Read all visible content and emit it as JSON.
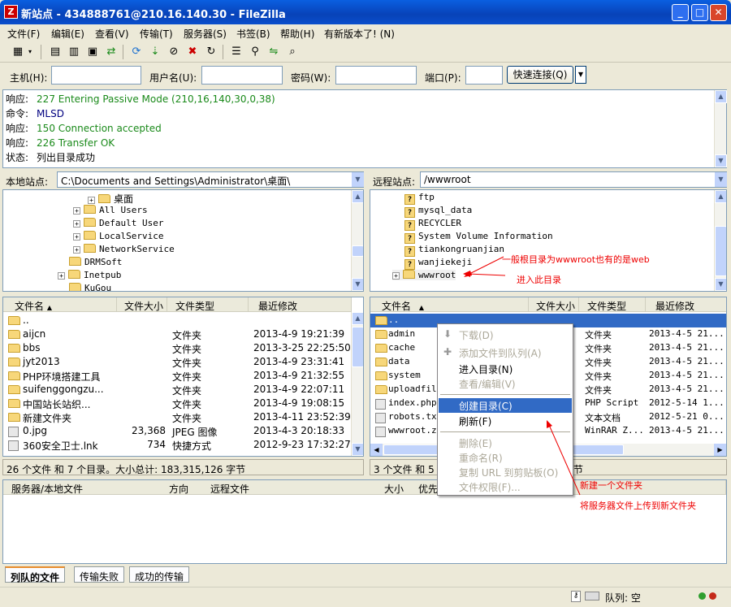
{
  "window": {
    "title": "新站点 - 434888761@210.16.140.30 - FileZilla",
    "min": "_",
    "max": "□",
    "close": "✕"
  },
  "menu": [
    "文件(F)",
    "编辑(E)",
    "查看(V)",
    "传输(T)",
    "服务器(S)",
    "书签(B)",
    "帮助(H)",
    "有新版本了! (N)"
  ],
  "quick": {
    "host_label": "主机(H):",
    "user_label": "用户名(U):",
    "pass_label": "密码(W):",
    "port_label": "端口(P):",
    "connect": "快速连接(Q)"
  },
  "log": [
    {
      "k": "响应:",
      "v": "227 Entering Passive Mode (210,16,140,30,0,38)",
      "c": "#008000"
    },
    {
      "k": "命令:",
      "v": "MLSD",
      "c": "#000080"
    },
    {
      "k": "响应:",
      "v": "150 Connection accepted",
      "c": "#008000"
    },
    {
      "k": "响应:",
      "v": "226 Transfer OK",
      "c": "#008000"
    },
    {
      "k": "状态:",
      "v": "列出目录成功",
      "c": "#000000"
    }
  ],
  "local": {
    "label": "本地站点:",
    "path": "C:\\Documents and Settings\\Administrator\\桌面\\",
    "tree": [
      "桌面",
      "All Users",
      "Default User",
      "LocalService",
      "NetworkService",
      "DRMSoft",
      "Inetpub",
      "KuGou"
    ],
    "headers": [
      "文件名",
      "文件大小",
      "文件类型",
      "最近修改"
    ],
    "rows": [
      {
        "n": "..",
        "s": "",
        "t": "",
        "d": ""
      },
      {
        "n": "aijcn",
        "s": "",
        "t": "文件夹",
        "d": "2013-4-9 19:21:39"
      },
      {
        "n": "bbs",
        "s": "",
        "t": "文件夹",
        "d": "2013-3-25 22:25:50"
      },
      {
        "n": "jyt2013",
        "s": "",
        "t": "文件夹",
        "d": "2013-4-9 23:31:41"
      },
      {
        "n": "PHP环境搭建工具",
        "s": "",
        "t": "文件夹",
        "d": "2013-4-9 21:32:55"
      },
      {
        "n": "suifenggongzu...",
        "s": "",
        "t": "文件夹",
        "d": "2013-4-9 22:07:11"
      },
      {
        "n": "中国站长站织...",
        "s": "",
        "t": "文件夹",
        "d": "2013-4-9 19:08:15"
      },
      {
        "n": "新建文件夹",
        "s": "",
        "t": "文件夹",
        "d": "2013-4-11 23:52:39"
      },
      {
        "n": "0.jpg",
        "s": "23,368",
        "t": "JPEG 图像",
        "d": "2013-4-3 20:18:33"
      },
      {
        "n": "360安全卫士.lnk",
        "s": "734",
        "t": "快捷方式",
        "d": "2012-9-23 17:32:27"
      }
    ],
    "status": "26 个文件 和 7 个目录。大小总计: 183,315,126 字节"
  },
  "remote": {
    "label": "远程站点:",
    "path": "/wwwroot",
    "tree": [
      "ftp",
      "mysql_data",
      "RECYCLER",
      "System Volume Information",
      "tiankongruanjian",
      "wanjiekeji",
      "wwwroot"
    ],
    "headers": [
      "文件名",
      "文件大小",
      "文件类型",
      "最近修改"
    ],
    "rows": [
      {
        "n": "..",
        "t": "",
        "d": ""
      },
      {
        "n": "admin",
        "t": "文件夹",
        "d": "2013-4-5 21..."
      },
      {
        "n": "cache",
        "t": "文件夹",
        "d": "2013-4-5 21..."
      },
      {
        "n": "data",
        "t": "文件夹",
        "d": "2013-4-5 21..."
      },
      {
        "n": "system",
        "t": "文件夹",
        "d": "2013-4-5 21..."
      },
      {
        "n": "uploadfile",
        "t": "文件夹",
        "d": "2013-4-5 21..."
      },
      {
        "n": "index.php",
        "t": "PHP Script",
        "d": "2012-5-14 1..."
      },
      {
        "n": "robots.txt",
        "t": "文本文档",
        "d": "2012-5-21 0..."
      },
      {
        "n": "wwwroot.zi",
        "t": "WinRAR Z...",
        "d": "2013-4-5 21..."
      }
    ],
    "status_a": "3 个文件 和 5",
    "status_b": "节"
  },
  "queue": {
    "headers": [
      "服务器/本地文件",
      "方向",
      "远程文件",
      "大小",
      "优先"
    ]
  },
  "tabs": [
    "列队的文件",
    "传输失败",
    "成功的传输"
  ],
  "statusbar": {
    "queue": "队列: 空"
  },
  "context_menu": [
    {
      "label": "下载(D)",
      "dis": true
    },
    {
      "label": "添加文件到队列(A)",
      "dis": true
    },
    {
      "label": "进入目录(N)",
      "dis": false
    },
    {
      "label": "查看/编辑(V)",
      "dis": true
    },
    {
      "label": "创建目录(C)",
      "dis": false,
      "sel": true
    },
    {
      "label": "刷新(F)",
      "dis": false
    },
    {
      "label": "删除(E)",
      "dis": true
    },
    {
      "label": "重命名(R)",
      "dis": true
    },
    {
      "label": "复制 URL 到剪贴板(O)",
      "dis": true
    },
    {
      "label": "文件权限(F)...",
      "dis": true
    }
  ],
  "annotations": [
    "一般根目录为wwwroot也有的是web",
    "进入此目录",
    "新建一个文件夹",
    "将服务器文件上传到新文件夹"
  ]
}
